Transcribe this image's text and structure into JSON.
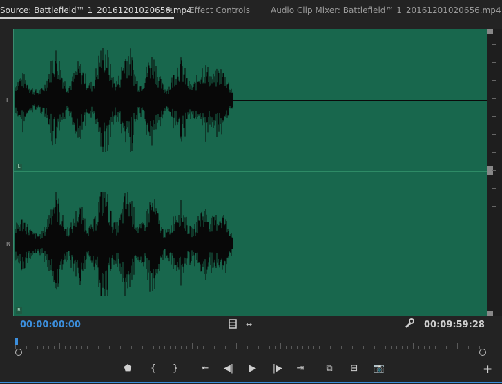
{
  "tabs": {
    "source": "Source: Battlefield™ 1_20161201020656.mp4",
    "effect_controls": "Effect Controls",
    "audio_clip_mixer": "Audio Clip Mixer: Battlefield™ 1_20161201020656.mp4",
    "menu_glyph": "≡"
  },
  "channels": {
    "left_label": "L",
    "right_label": "R",
    "left_tag": "L",
    "right_tag": "R"
  },
  "timecode": {
    "current": "00:00:00:00",
    "duration": "00:09:59:28"
  },
  "colors": {
    "waveform_bg": "#18674d",
    "accent": "#3c8fdd"
  },
  "icons": {
    "export_frame": "film-icon",
    "settings": "wrench-icon"
  },
  "controls": [
    {
      "name": "add-marker-button",
      "glyph": "⬟"
    },
    {
      "name": "mark-in-button",
      "glyph": "{"
    },
    {
      "name": "mark-out-button",
      "glyph": "}"
    },
    {
      "name": "go-to-in-button",
      "glyph": "⇤"
    },
    {
      "name": "step-back-button",
      "glyph": "◀|"
    },
    {
      "name": "play-button",
      "glyph": "▶"
    },
    {
      "name": "step-forward-button",
      "glyph": "|▶"
    },
    {
      "name": "go-to-out-button",
      "glyph": "⇥"
    },
    {
      "name": "insert-button",
      "glyph": "⧉"
    },
    {
      "name": "overwrite-button",
      "glyph": "⊟"
    },
    {
      "name": "export-frame-button",
      "glyph": "📷"
    }
  ],
  "add_button": "+"
}
